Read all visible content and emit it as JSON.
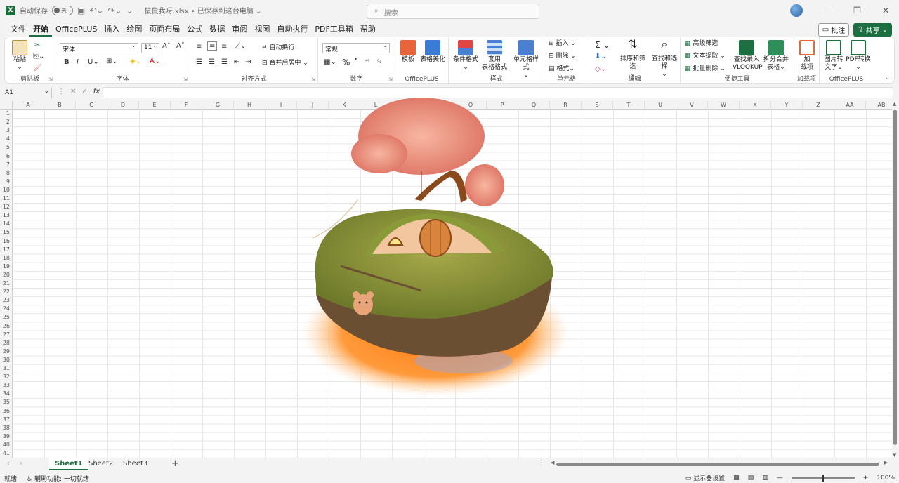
{
  "titlebar": {
    "autosave_label": "自动保存",
    "autosave_state": "关",
    "filename": "鼠鼠我呀.xlsx • 已保存到这台电脑 ⌄",
    "search_placeholder": "搜索"
  },
  "menu": {
    "items": [
      "文件",
      "开始",
      "OfficePLUS",
      "插入",
      "绘图",
      "页面布局",
      "公式",
      "数据",
      "审阅",
      "视图",
      "自动执行",
      "PDF工具箱",
      "帮助"
    ],
    "active": "开始",
    "comment_label": "批注",
    "share_label": "共享"
  },
  "ribbon": {
    "clipboard": {
      "paste": "粘贴",
      "label": "剪贴板"
    },
    "font": {
      "name": "宋体",
      "size": "11",
      "label": "字体"
    },
    "align": {
      "wrap": "自动换行",
      "merge": "合并后居中",
      "label": "对齐方式"
    },
    "number": {
      "format": "常规",
      "label": "数字"
    },
    "officeplus1": {
      "template": "模板",
      "beautify": "表格美化",
      "label": "OfficePLUS"
    },
    "styles": {
      "cond": "条件格式",
      "table_a": "套用",
      "table_b": "表格格式",
      "cell": "单元格样式",
      "label": "样式"
    },
    "cells": {
      "insert": "插入",
      "delete": "删除",
      "format": "格式",
      "label": "单元格"
    },
    "editing": {
      "sort": "排序和筛选",
      "find": "查找和选择",
      "label": "编辑"
    },
    "tools": {
      "advfilter": "高级筛选",
      "textextract": "文本提取",
      "bulkdelete": "批量删除",
      "lookup_a": "查找录入",
      "lookup_b": "VLOOKUP",
      "split_a": "拆分合并",
      "split_b": "表格",
      "label": "便捷工具"
    },
    "addins": {
      "addin_a": "加",
      "addin_b": "载项",
      "label": "加载项"
    },
    "officeplus2": {
      "img_a": "图片转",
      "img_b": "文字",
      "pdf": "PDF转换",
      "label": "OfficePLUS"
    }
  },
  "formula": {
    "namebox": "A1",
    "fx": "fx"
  },
  "columns": [
    "A",
    "B",
    "C",
    "D",
    "E",
    "F",
    "G",
    "H",
    "I",
    "J",
    "K",
    "L",
    "M",
    "N",
    "O",
    "P",
    "Q",
    "R",
    "S",
    "T",
    "U",
    "V",
    "W",
    "X",
    "Y",
    "Z",
    "AA",
    "AB"
  ],
  "rows": [
    "1",
    "2",
    "3",
    "4",
    "5",
    "6",
    "7",
    "8",
    "9",
    "10",
    "11",
    "12",
    "13",
    "14",
    "15",
    "16",
    "17",
    "18",
    "19",
    "20",
    "21",
    "22",
    "23",
    "24",
    "25",
    "26",
    "27",
    "28",
    "29",
    "30",
    "31",
    "32",
    "33",
    "34",
    "35",
    "36",
    "37",
    "38",
    "39",
    "40",
    "41"
  ],
  "sheets": [
    "Sheet1",
    "Sheet2",
    "Sheet3"
  ],
  "active_sheet": "Sheet1",
  "status": {
    "ready": "就绪",
    "accessibility": "辅助功能: 一切就绪",
    "display_settings": "显示器设置",
    "zoom": "100%"
  },
  "colors": {
    "accent": "#1d6f42"
  }
}
